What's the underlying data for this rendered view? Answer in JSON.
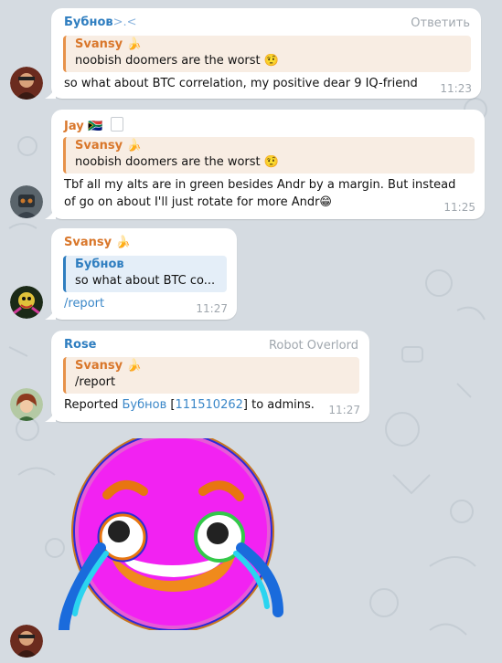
{
  "colors": {
    "background": "#d5dbe1",
    "bubble": "#ffffff",
    "orange": "#d9772b",
    "blue": "#2f7ec0",
    "link": "#3a87c8",
    "muted": "#a0a7ae",
    "replyOrange": "#f8ede3",
    "replyBlue": "#e4eef8"
  },
  "messages": [
    {
      "sender": "Бубнов",
      "sender_suffix": ">.<",
      "action": "Ответить",
      "reply_name": "Svansy 🍌",
      "reply_text": "noobish doomers are the worst 🤨",
      "text": "so what about BTC correlation, my positive dear 9 IQ-friend",
      "time": "11:23"
    },
    {
      "sender": "Jay 🇿🇦",
      "reply_name": "Svansy 🍌",
      "reply_text": "noobish doomers are the worst 🤨",
      "text_line1": "Tbf all my alts are in green besides Andr by a margin. But instead",
      "text_line2": "of go on about I'll just rotate for more Andr😁",
      "time": "11:25"
    },
    {
      "sender": "Svansy 🍌",
      "reply_name": "Бубнов",
      "reply_text": "so what about BTC co...",
      "text": "/report",
      "time": "11:27"
    },
    {
      "sender": "Rose",
      "title": "Robot Overlord",
      "reply_name": "Svansy 🍌",
      "reply_text": "/report",
      "text_prefix": "Reported ",
      "text_user": "Бубнов",
      "text_id": "[111510262]",
      "text_suffix": " to admins.",
      "time": "11:27"
    }
  ],
  "sticker": {
    "name": "laughing-crying-emoji-sticker"
  }
}
